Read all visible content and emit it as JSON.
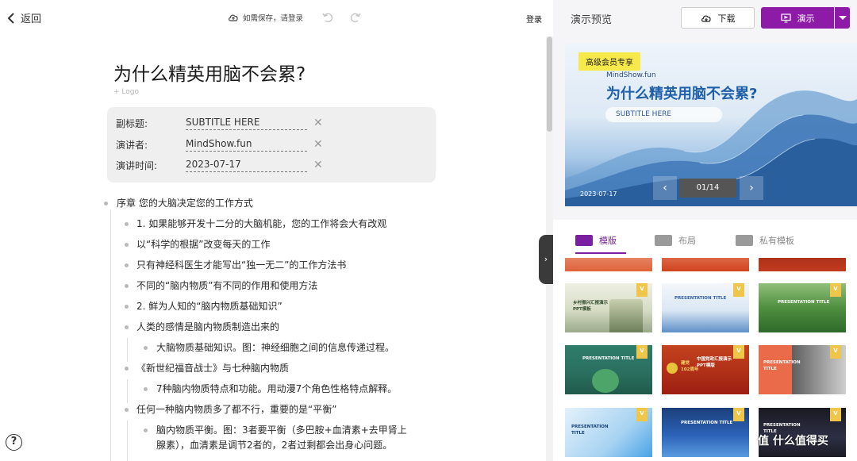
{
  "topbar": {
    "back_label": "返回",
    "save_status": "如需保存，请登录",
    "login_label": "登录"
  },
  "document": {
    "title": "为什么精英用脑不会累?",
    "add_logo": "+ Logo",
    "meta": {
      "subtitle_label": "副标题:",
      "subtitle_value": "SUBTITLE HERE",
      "speaker_label": "演讲者:",
      "speaker_value": "MindShow.fun",
      "time_label": "演讲时间:",
      "time_value": "2023-07-17"
    },
    "outline": [
      "序章 您的大脑决定您的工作方式",
      "1. 如果能够开发十二分的大脑机能，您的工作将会大有改观",
      "以“科学的根据”改变每天的工作",
      "只有神经科医生才能写出“独一无二”的工作方法书",
      "不同的“脑内物质”有不同的作用和使用方法",
      "2. 鲜为人知的“脑内物质基础知识”",
      "人类的感情是脑内物质制造出来的",
      "大脑物质基础知识。图：神经细胞之间的信息传递过程。",
      "《新世纪福音战士》与七种脑内物质",
      "7种脑内物质特点和功能。用动漫7个角色性格特点解释。",
      "任何一种脑内物质多了都不行，重要的是“平衡”",
      "脑内物质平衡。图：3者要平衡（多巴胺+血清素+去甲肾上",
      "腺素），血清素是调节2者的，2者过剩都会出身心问题。"
    ],
    "help": "?"
  },
  "right_panel": {
    "title": "演示预览",
    "download_label": "下载",
    "present_label": "演示",
    "preview": {
      "badge": "高级会员专享",
      "brand": "MindShow.fun",
      "title": "为什么精英用脑不会累?",
      "subtitle": "SUBTITLE HERE",
      "date": "2023-07-17",
      "page": "01/14"
    },
    "tabs": [
      {
        "label": "模版",
        "active": true
      },
      {
        "label": "布局",
        "active": false
      },
      {
        "label": "私有模板",
        "active": false
      }
    ],
    "thumb_texts": {
      "t1": "乡村振兴汇报演示PPT模板",
      "t2": "PRESENTATION TITLE",
      "t3": "PRESENTATION TITLE",
      "t4": "PRESENTATION TITLE",
      "t5a": "建党",
      "t5b": "102周年",
      "t5c": "中国党政汇报演示PPT模版",
      "t6": "PRESENTATION TITLE",
      "t7": "PRESENTATION TITLE",
      "t8": "PRESENTATION TITLE",
      "t9": "PRESENTATION TITLE"
    },
    "watermark": "值 什么值得买"
  }
}
